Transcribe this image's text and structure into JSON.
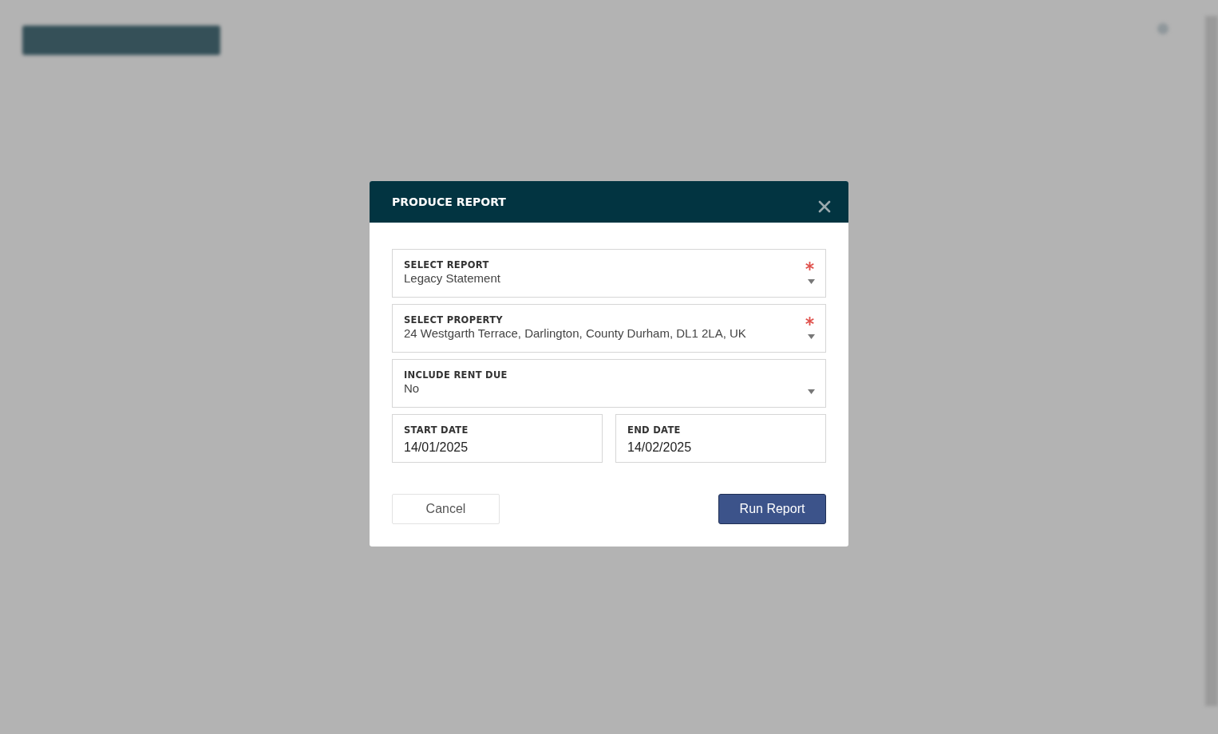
{
  "dialog": {
    "title": "PRODUCE REPORT",
    "fields": [
      {
        "kind": "select",
        "label": "SELECT REPORT",
        "value": "Legacy Statement",
        "required": true
      },
      {
        "kind": "select",
        "label": "SELECT PROPERTY",
        "value": "24 Westgarth Terrace, Darlington, County Durham, DL1 2LA, UK",
        "required": true
      },
      {
        "kind": "select",
        "label": "INCLUDE RENT DUE",
        "value": "No",
        "required": false
      },
      {
        "kind": "date",
        "label": "START DATE",
        "value": "14/01/2025",
        "required": false
      },
      {
        "kind": "date",
        "label": "END DATE",
        "value": "14/02/2025",
        "required": false
      }
    ],
    "buttons": [
      {
        "kind": "secondary",
        "label": "Cancel"
      },
      {
        "kind": "primary",
        "label": "Run Report"
      }
    ]
  }
}
